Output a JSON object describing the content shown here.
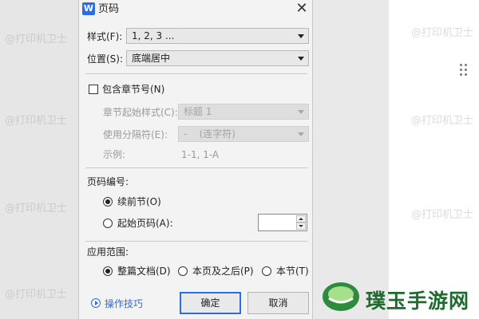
{
  "dialog": {
    "title": "页码",
    "app_icon_letter": "W",
    "close_glyph": "✕"
  },
  "style_row": {
    "label": "样式(F):",
    "value": "1, 2, 3 ..."
  },
  "position_row": {
    "label": "位置(S):",
    "value": "底端居中"
  },
  "include_chapter": {
    "label": "包含章节号(N)",
    "checked": false
  },
  "chapter_start": {
    "label": "章节起始样式(C):",
    "value": "标题 1"
  },
  "separator_row": {
    "label": "使用分隔符(E):",
    "value": "-    (连字符)"
  },
  "example_row": {
    "label": "示例:",
    "value": "1-1, 1-A"
  },
  "numbering": {
    "group_label": "页码编号:",
    "continue_label": "续前节(O)",
    "start_label": "起始页码(A):",
    "start_value": "",
    "selected": "continue"
  },
  "scope": {
    "group_label": "应用范围:",
    "options": [
      "整篇文档(D)",
      "本页及之后(P)",
      "本节(T)"
    ],
    "selected_index": 0
  },
  "footer": {
    "help_label": "操作技巧",
    "ok_label": "确定",
    "cancel_label": "取消"
  },
  "watermark_text": "@打印机卫士",
  "brand_text": "璞玉手游网",
  "colors": {
    "accent": "#2b6de3",
    "brand_green": "#1f6a2f"
  }
}
